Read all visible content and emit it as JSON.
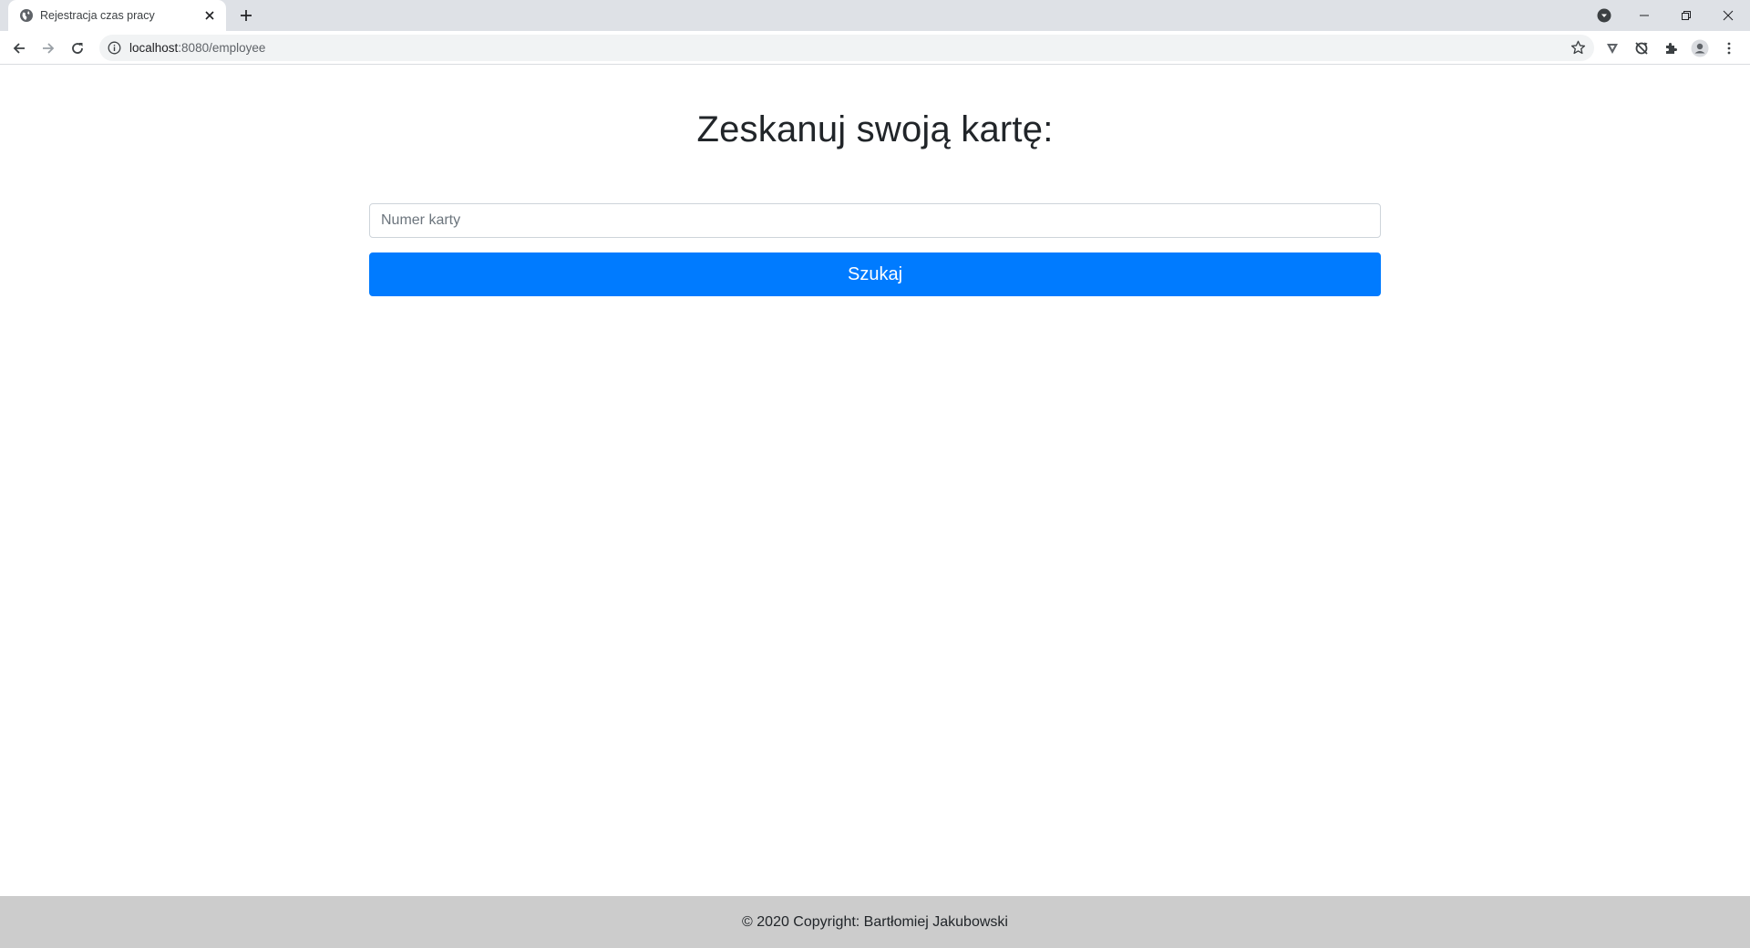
{
  "browser": {
    "tab_title": "Rejestracja czas pracy",
    "url_host": "localhost",
    "url_rest": ":8080/employee"
  },
  "page": {
    "heading": "Zeskanuj swoją kartę:",
    "card_input": {
      "placeholder": "Numer karty",
      "value": ""
    },
    "search_label": "Szukaj",
    "footer": "© 2020 Copyright: Bartłomiej Jakubowski"
  },
  "colors": {
    "primary": "#007bff",
    "footer_bg": "#cccccc",
    "tabstrip_bg": "#dee1e6"
  },
  "icons": [
    "globe-icon",
    "close-icon",
    "plus-icon",
    "profile-dropdown-icon",
    "minimize-icon",
    "restore-icon",
    "window-close-icon",
    "back-arrow-icon",
    "forward-arrow-icon",
    "reload-icon",
    "info-icon",
    "star-icon",
    "vpn-extension-icon",
    "sync-extension-icon",
    "puzzle-icon",
    "avatar-icon",
    "kebab-menu-icon"
  ]
}
